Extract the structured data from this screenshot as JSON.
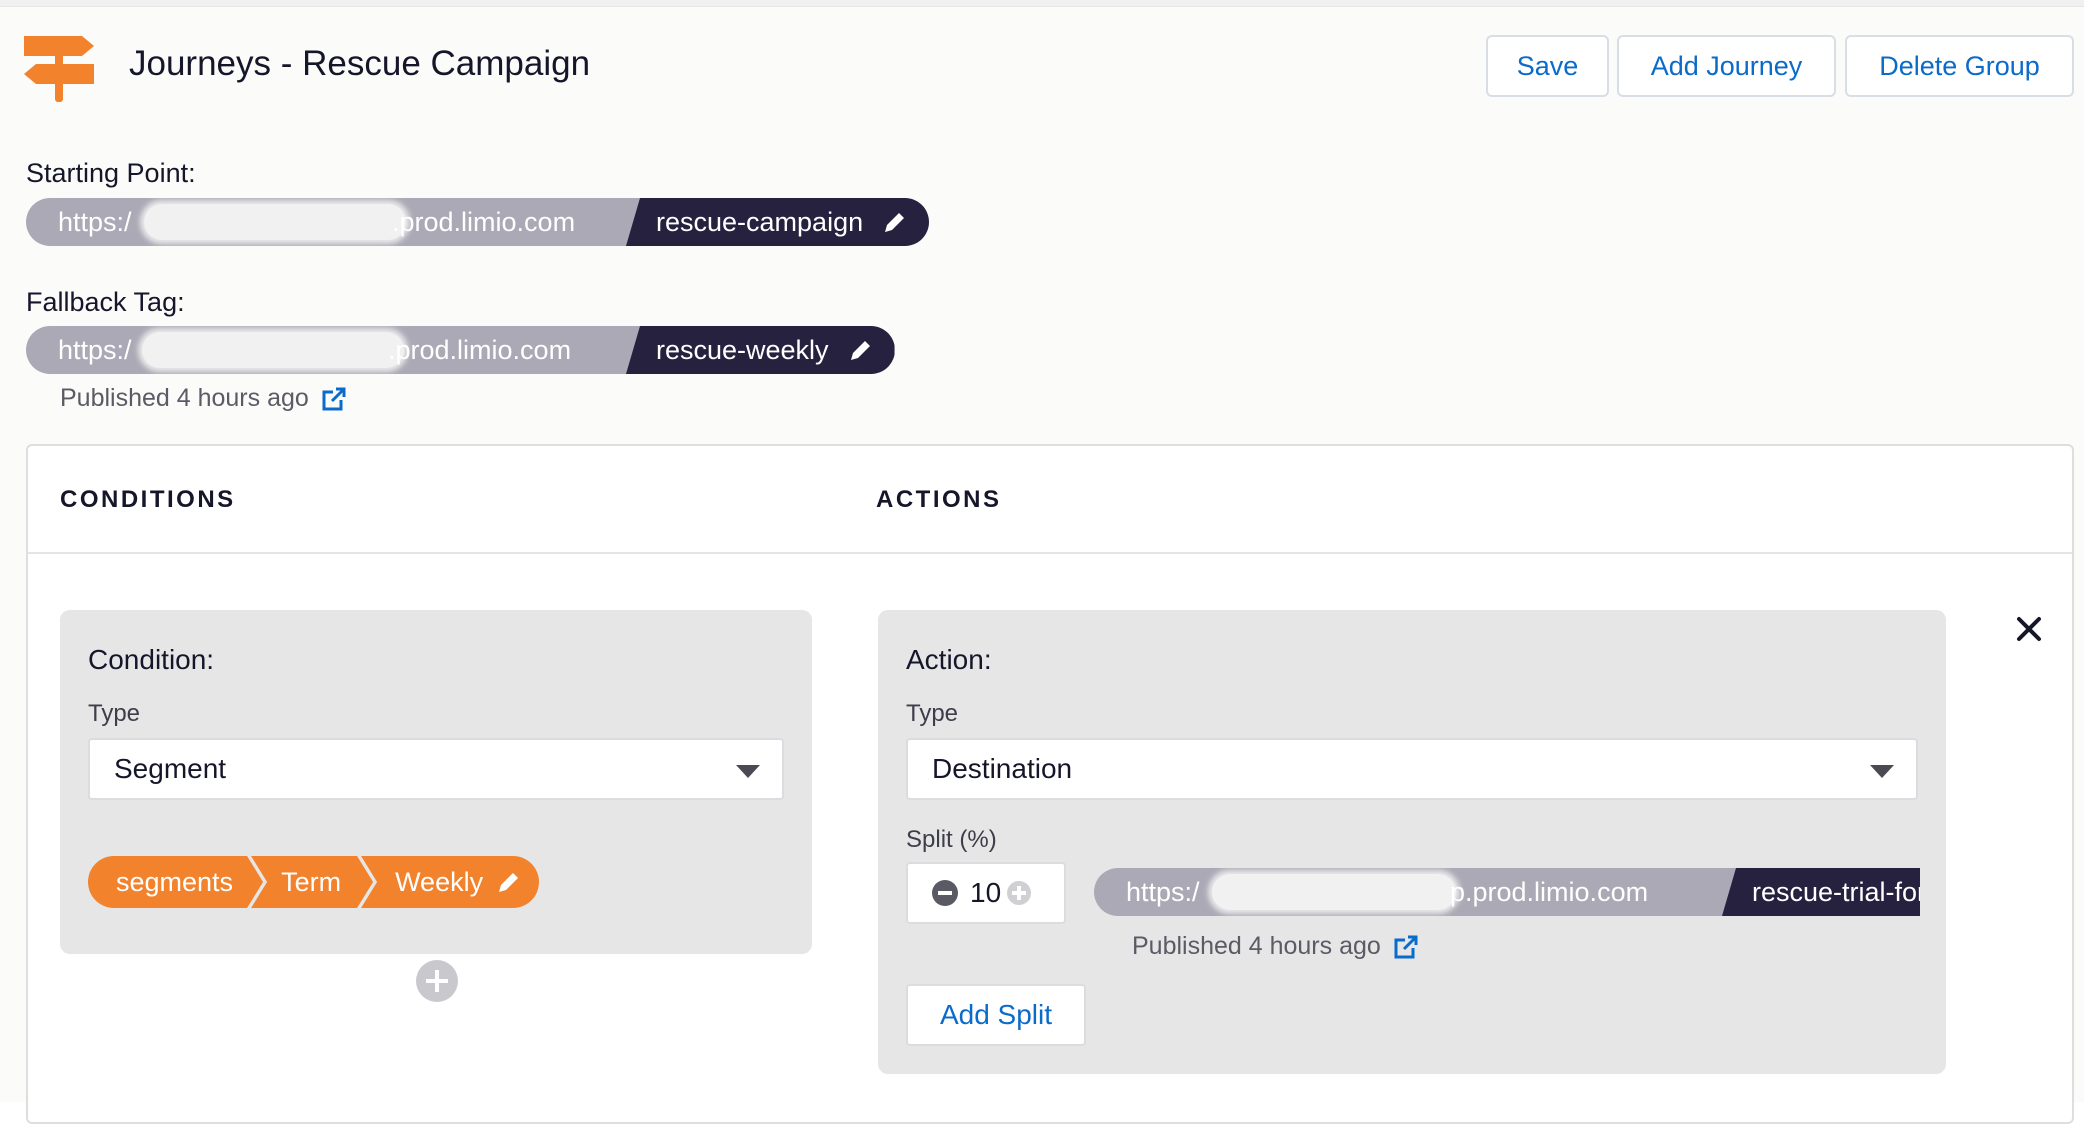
{
  "header": {
    "title": "Journeys - Rescue Campaign",
    "buttons": {
      "save": "Save",
      "add_journey": "Add Journey",
      "delete_group": "Delete Group"
    },
    "icon": "signpost-icon"
  },
  "starting_point": {
    "label": "Starting Point:",
    "url_prefix": "https:/",
    "url_domain": ".prod.limio.com",
    "tag": "rescue-campaign"
  },
  "fallback": {
    "label": "Fallback Tag:",
    "url_prefix": "https:/",
    "url_domain": ".prod.limio.com",
    "tag": "rescue-weekly",
    "published": "Published 4 hours ago"
  },
  "panel": {
    "conditions_header": "CONDITIONS",
    "actions_header": "ACTIONS",
    "condition": {
      "title": "Condition:",
      "type_label": "Type",
      "type_value": "Segment",
      "chips": [
        "segments",
        "Term",
        "Weekly"
      ]
    },
    "action": {
      "title": "Action:",
      "type_label": "Type",
      "type_value": "Destination",
      "split_label": "Split (%)",
      "split_value": "10",
      "url_prefix": "https:/",
      "url_domain": "p.prod.limio.com",
      "tag": "rescue-trial-fortni",
      "published": "Published 4 hours ago",
      "add_split": "Add Split"
    }
  },
  "colors": {
    "accent_orange": "#f2822c",
    "link_blue": "#0b6bcb",
    "tag_dark": "#25213f",
    "url_gray": "#aaa9b5"
  }
}
